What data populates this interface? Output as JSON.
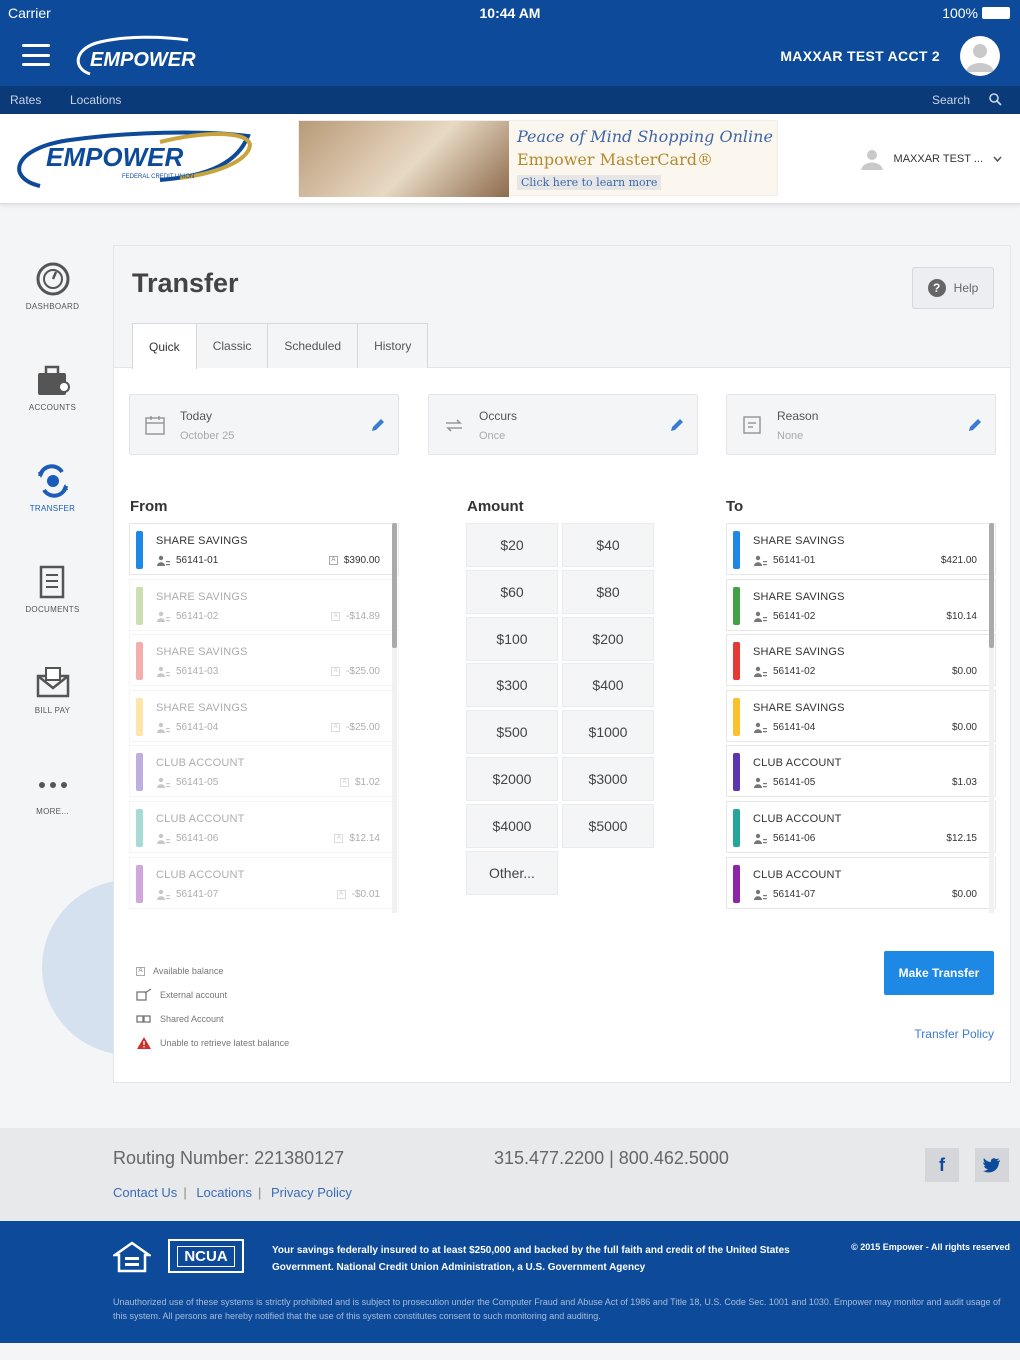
{
  "status_bar": {
    "carrier": "Carrier",
    "time": "10:44 AM",
    "battery": "100%"
  },
  "app_bar": {
    "logo_text": "EMPOWER",
    "account_name": "MAXXAR TEST ACCT 2"
  },
  "nav_bar": {
    "rates": "Rates",
    "locations": "Locations",
    "search": "Search"
  },
  "header": {
    "logo_text": "EMPOWER",
    "logo_subtext": "FEDERAL CREDIT UNION",
    "banner": {
      "line1": "Peace of Mind Shopping Online",
      "line2": "Empower MasterCard®",
      "line3": "Click here to learn more"
    },
    "user_menu": "MAXXAR TEST ..."
  },
  "sidenav": [
    {
      "label": "DASHBOARD",
      "icon": "dashboard-icon"
    },
    {
      "label": "ACCOUNTS",
      "icon": "wallet-icon"
    },
    {
      "label": "TRANSFER",
      "icon": "transfer-icon"
    },
    {
      "label": "DOCUMENTS",
      "icon": "documents-icon"
    },
    {
      "label": "BILL PAY",
      "icon": "bill-pay-icon"
    },
    {
      "label": "MORE...",
      "icon": "more-icon"
    }
  ],
  "transfer": {
    "title": "Transfer",
    "help": "Help",
    "tabs": [
      "Quick",
      "Classic",
      "Scheduled",
      "History"
    ],
    "date": {
      "label": "Today",
      "value": "October 25"
    },
    "occurs": {
      "label": "Occurs",
      "value": "Once"
    },
    "reason": {
      "label": "Reason",
      "value": "None"
    },
    "from_label": "From",
    "amount_label": "Amount",
    "to_label": "To",
    "from_accounts": [
      {
        "name": "SHARE SAVINGS",
        "number": "56141-01",
        "balance": "$390.00",
        "color": "#1e88e5"
      },
      {
        "name": "SHARE SAVINGS",
        "number": "56141-02",
        "balance": "-$14.89",
        "color": "#7cb342"
      },
      {
        "name": "SHARE SAVINGS",
        "number": "56141-03",
        "balance": "-$25.00",
        "color": "#e53935"
      },
      {
        "name": "SHARE SAVINGS",
        "number": "56141-04",
        "balance": "-$25.00",
        "color": "#fbc02d"
      },
      {
        "name": "CLUB ACCOUNT",
        "number": "56141-05",
        "balance": "$1.02",
        "color": "#5e35b1"
      },
      {
        "name": "CLUB ACCOUNT",
        "number": "56141-06",
        "balance": "$12.14",
        "color": "#26a69a"
      },
      {
        "name": "CLUB ACCOUNT",
        "number": "56141-07",
        "balance": "-$0.01",
        "color": "#8e24aa"
      }
    ],
    "amounts": [
      "$20",
      "$40",
      "$60",
      "$80",
      "$100",
      "$200",
      "$300",
      "$400",
      "$500",
      "$1000",
      "$2000",
      "$3000",
      "$4000",
      "$5000",
      "Other..."
    ],
    "to_accounts": [
      {
        "name": "SHARE SAVINGS",
        "number": "56141-01",
        "balance": "$421.00",
        "color": "#1e88e5"
      },
      {
        "name": "SHARE SAVINGS",
        "number": "56141-02",
        "balance": "$10.14",
        "color": "#43a047"
      },
      {
        "name": "SHARE SAVINGS",
        "number": "56141-02",
        "balance": "$0.00",
        "color": "#e53935"
      },
      {
        "name": "SHARE SAVINGS",
        "number": "56141-04",
        "balance": "$0.00",
        "color": "#fbc02d"
      },
      {
        "name": "CLUB ACCOUNT",
        "number": "56141-05",
        "balance": "$1.03",
        "color": "#5e35b1"
      },
      {
        "name": "CLUB ACCOUNT",
        "number": "56141-06",
        "balance": "$12.15",
        "color": "#26a69a"
      },
      {
        "name": "CLUB ACCOUNT",
        "number": "56141-07",
        "balance": "$0.00",
        "color": "#8e24aa"
      }
    ],
    "legend": [
      "Available balance",
      "External account",
      "Shared Account",
      "Unable to retrieve latest balance"
    ],
    "make_transfer": "Make Transfer",
    "policy": "Transfer Policy"
  },
  "footer": {
    "routing": "Routing Number: 221380127",
    "phones": "315.477.2200  |  800.462.5000",
    "links": [
      "Contact Us",
      "Locations",
      "Privacy Policy"
    ],
    "facebook": "f",
    "ncua": "NCUA",
    "insured": "Your savings federally insured to at least $250,000 and backed by the full faith and credit of the United States Government. National Credit Union Administration, a U.S. Government Agency",
    "copyright": "© 2015 Empower - All rights reserved",
    "disclaimer": "Unauthorized use of these systems is strictly prohibited and is subject to prosecution under the Computer Fraud and Abuse Act of 1986 and Title 18, U.S. Code Sec. 1001 and 1030. Empower may monitor and audit usage of this system. All persons are hereby notified that the use of this system constitutes consent to such monitoring and auditing."
  },
  "colors": {
    "brand_blue": "#0d4b9a",
    "button_blue": "#1e88e5",
    "link_blue": "#3a7bd5"
  }
}
